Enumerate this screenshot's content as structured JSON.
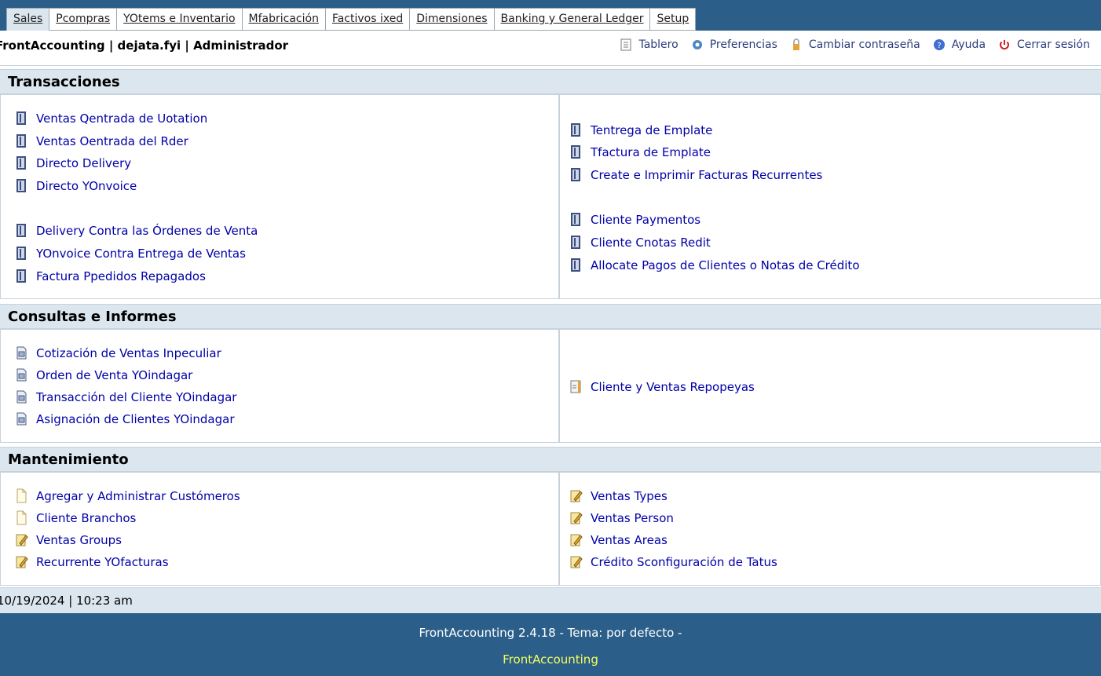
{
  "tabs": [
    {
      "label": "Sales",
      "active": true
    },
    {
      "label": "Pcompras"
    },
    {
      "label": "YOtems e Inventario"
    },
    {
      "label": "Mfabricación"
    },
    {
      "label": "Factivos ixed"
    },
    {
      "label": "Dimensiones"
    },
    {
      "label": "Banking y General Ledger"
    },
    {
      "label": "Setup"
    }
  ],
  "header": {
    "company_line": "FrontAccounting | dejata.fyi | Administrador",
    "links": [
      "Tablero",
      "Preferencias",
      "Cambiar contraseña",
      "Ayuda",
      "Cerrar sesión"
    ]
  },
  "sections": {
    "transacciones": {
      "title": "Transacciones",
      "left": [
        "Ventas Qentrada de Uotation",
        "Ventas Oentrada del Rder",
        "Directo Delivery",
        "Directo YOnvoice",
        "Delivery Contra las Órdenes de Venta",
        "YOnvoice Contra Entrega de Ventas",
        "Factura Ppedidos Repagados"
      ],
      "right": [
        "Tentrega de Emplate",
        "Tfactura de Emplate",
        "Create e Imprimir Facturas Recurrentes",
        "Cliente Paymentos",
        "Cliente Cnotas Redit",
        "Allocate Pagos de Clientes o Notas de Crédito"
      ]
    },
    "consultas": {
      "title": "Consultas e Informes",
      "left": [
        "Cotización de Ventas Inpeculiar",
        "Orden de Venta YOindagar",
        "Transacción del Cliente YOindagar",
        "Asignación de Clientes YOindagar"
      ],
      "right": [
        "Cliente y Ventas Repopeyas"
      ]
    },
    "mantenimiento": {
      "title": "Mantenimiento",
      "left": [
        "Agregar y Administrar Custómeros",
        "Cliente Branchos",
        "Ventas Groups",
        "Recurrente YOfacturas"
      ],
      "right": [
        "Ventas Types",
        "Ventas Person",
        "Ventas Areas",
        "Crédito Sconfiguración de Tatus"
      ]
    }
  },
  "datetime": "10/19/2024 | 10:23 am",
  "footer": {
    "version": "FrontAccounting 2.4.18 - Tema: por defecto -",
    "link": "FrontAccounting"
  },
  "colors": {
    "bar": "#2b5f8a",
    "section": "#dbe6ef",
    "link": "#0000a8",
    "footer_link": "#f7ff5b"
  },
  "icons": {
    "transaction": "binder-icon",
    "inquiry": "report-icon",
    "maintenance_doc": "document-icon",
    "maintenance_edit": "notepad-pencil-icon"
  }
}
